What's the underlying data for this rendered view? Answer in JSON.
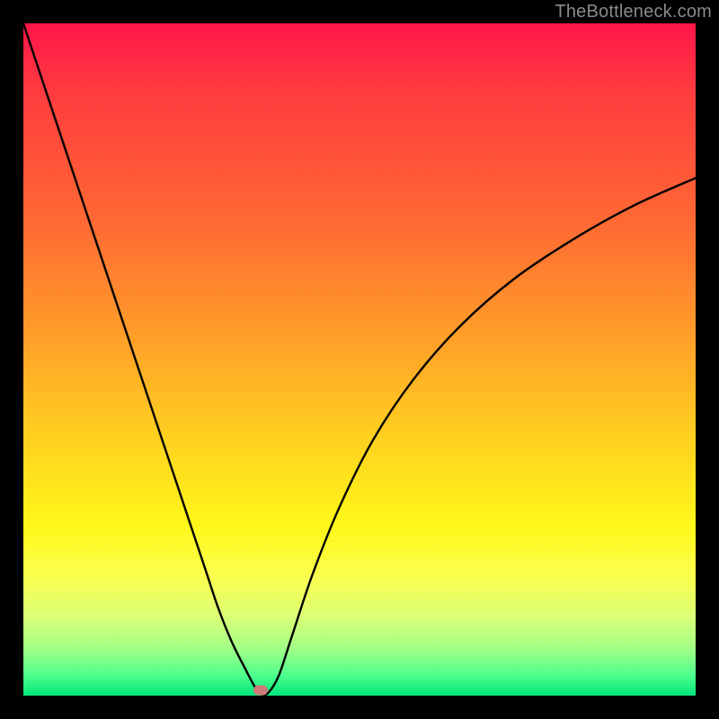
{
  "watermark": "TheBottleneck.com",
  "chart_data": {
    "type": "line",
    "title": "",
    "xlabel": "",
    "ylabel": "",
    "xlim": [
      0,
      100
    ],
    "ylim": [
      0,
      100
    ],
    "gradient_stops": [
      {
        "pos": 0,
        "color": "#ff1549"
      },
      {
        "pos": 10,
        "color": "#ff3b3f"
      },
      {
        "pos": 30,
        "color": "#ff6a33"
      },
      {
        "pos": 48,
        "color": "#ffa328"
      },
      {
        "pos": 62,
        "color": "#ffd21f"
      },
      {
        "pos": 75,
        "color": "#fff81a"
      },
      {
        "pos": 82,
        "color": "#fbff4d"
      },
      {
        "pos": 88,
        "color": "#dcff74"
      },
      {
        "pos": 93,
        "color": "#a2ff87"
      },
      {
        "pos": 97,
        "color": "#4dff8c"
      },
      {
        "pos": 100,
        "color": "#00e57a"
      }
    ],
    "series": [
      {
        "name": "curve",
        "x": [
          0,
          3,
          6,
          9,
          12,
          15,
          18,
          21,
          24,
          27,
          29,
          31,
          33,
          34.5,
          35.5,
          36.5,
          38,
          40,
          43,
          47,
          52,
          58,
          65,
          73,
          82,
          91,
          100
        ],
        "y": [
          100,
          91,
          82,
          73,
          64,
          55,
          46,
          37,
          28,
          19,
          13,
          8,
          4,
          1.2,
          0.2,
          0.5,
          3,
          9,
          18,
          28,
          38,
          47,
          55,
          62,
          68,
          73,
          77
        ]
      }
    ],
    "marker": {
      "x": 35.3,
      "y": 0.8,
      "color": "#cf7a78"
    }
  }
}
